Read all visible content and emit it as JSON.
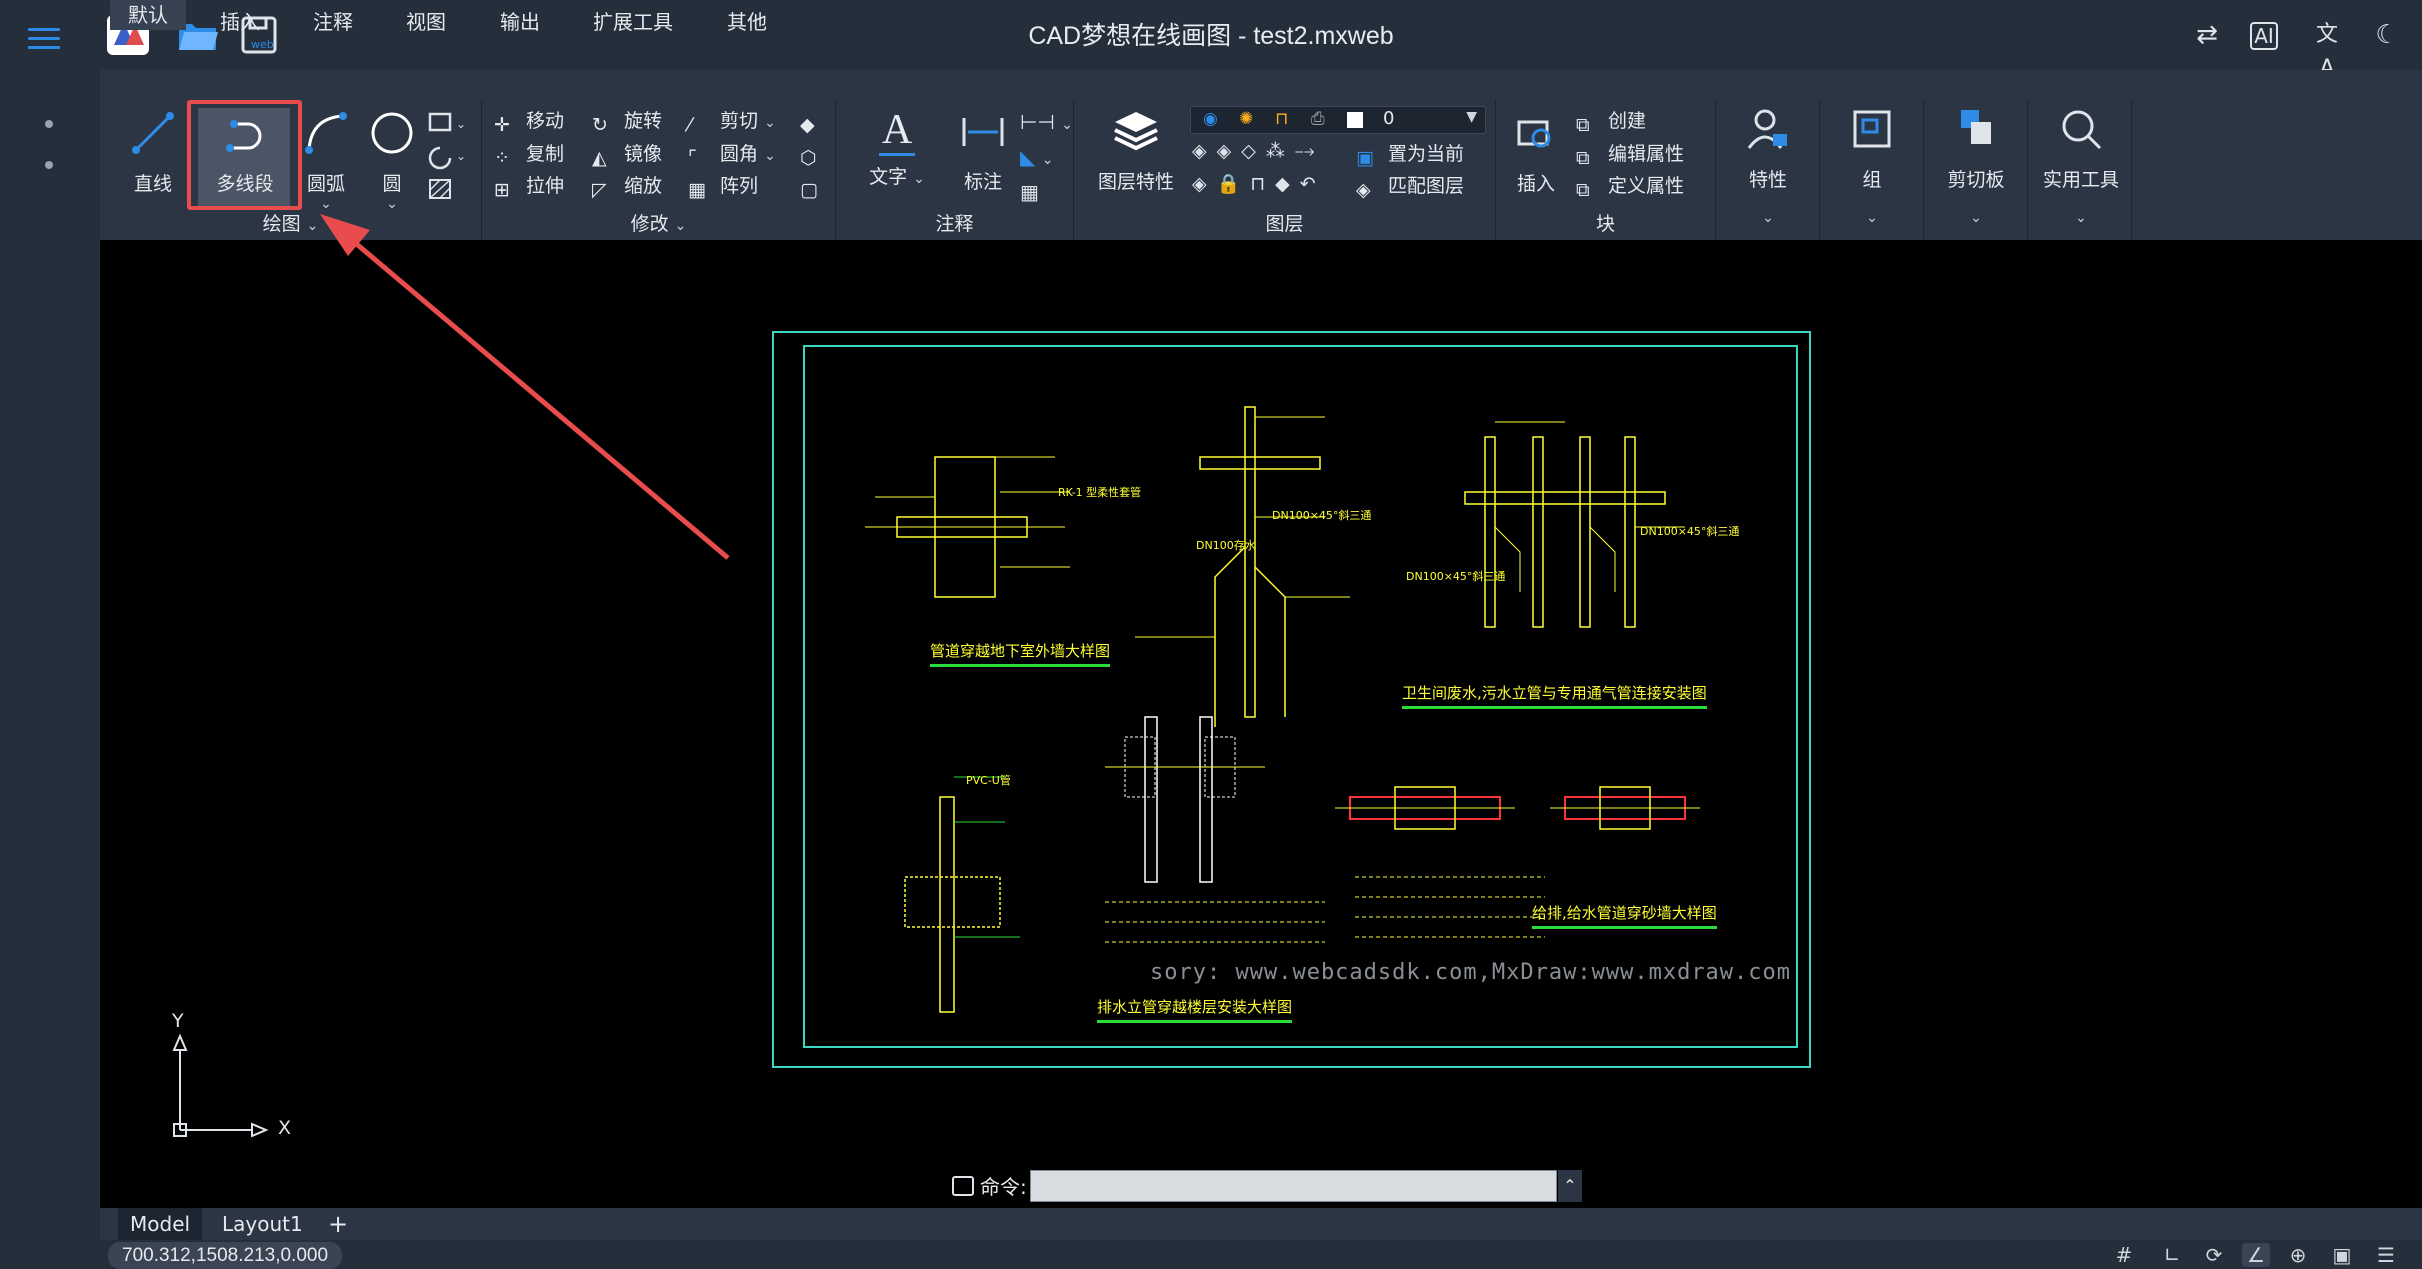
{
  "window": {
    "title": "CAD梦想在线画图 - test2.mxweb"
  },
  "toolbar_icons": [
    "menu-icon",
    "app-logo-icon",
    "folder-open-icon",
    "save-web-icon"
  ],
  "right_icons": [
    "swap-icon",
    "ai-icon",
    "translate-icon",
    "moon-icon"
  ],
  "ribbon": {
    "tabs": [
      "默认",
      "插入",
      "注释",
      "视图",
      "输出",
      "扩展工具",
      "其他"
    ],
    "active_tab": "默认",
    "groups": {
      "draw": {
        "label": "绘图",
        "line": "直线",
        "polyline": "多线段",
        "arc": "圆弧",
        "circle": "圆"
      },
      "modify": {
        "label": "修改",
        "move": "移动",
        "rotate": "旋转",
        "trim": "剪切",
        "copy": "复制",
        "mirror": "镜像",
        "fillet": "圆角",
        "stretch": "拉伸",
        "scale": "缩放",
        "array": "阵列"
      },
      "annotation": {
        "label": "注释",
        "text": "文字",
        "dimension": "标注"
      },
      "layer": {
        "label": "图层",
        "properties": "图层特性",
        "current_layer": "0",
        "set_current": "置为当前",
        "match_layer": "匹配图层"
      },
      "block": {
        "label": "块",
        "insert": "插入",
        "create": "创建",
        "edit_attr": "编辑属性",
        "define_attr": "定义属性"
      },
      "properties": {
        "label": "特性"
      },
      "group": {
        "label": "组"
      },
      "clipboard": {
        "label": "剪切板"
      },
      "utilities": {
        "label": "实用工具"
      }
    }
  },
  "drawing": {
    "titles": [
      "管道穿越地下室外墙大样图",
      "卫生间废水,污水立管与专用通气管连接安装图",
      "排水立管穿越楼层安装大样图",
      "给排,给水管道穿砂墙大样图"
    ],
    "labels": [
      "DN100×45°斜三通",
      "DN100存水",
      "DN100×45°斜三通",
      "RK-1 型柔性套管",
      "PVC-U管",
      "DN100×45°斜三通"
    ],
    "watermark": "sory: www.webcadsdk.com,MxDraw:www.mxdraw.com"
  },
  "axes": {
    "y": "Y",
    "x": "X"
  },
  "layout_tabs": [
    "Model",
    "Layout1"
  ],
  "add_tab": "+",
  "command": {
    "label": "命令:",
    "value": ""
  },
  "status": {
    "coords": "700.312,1508.213,0.000"
  }
}
